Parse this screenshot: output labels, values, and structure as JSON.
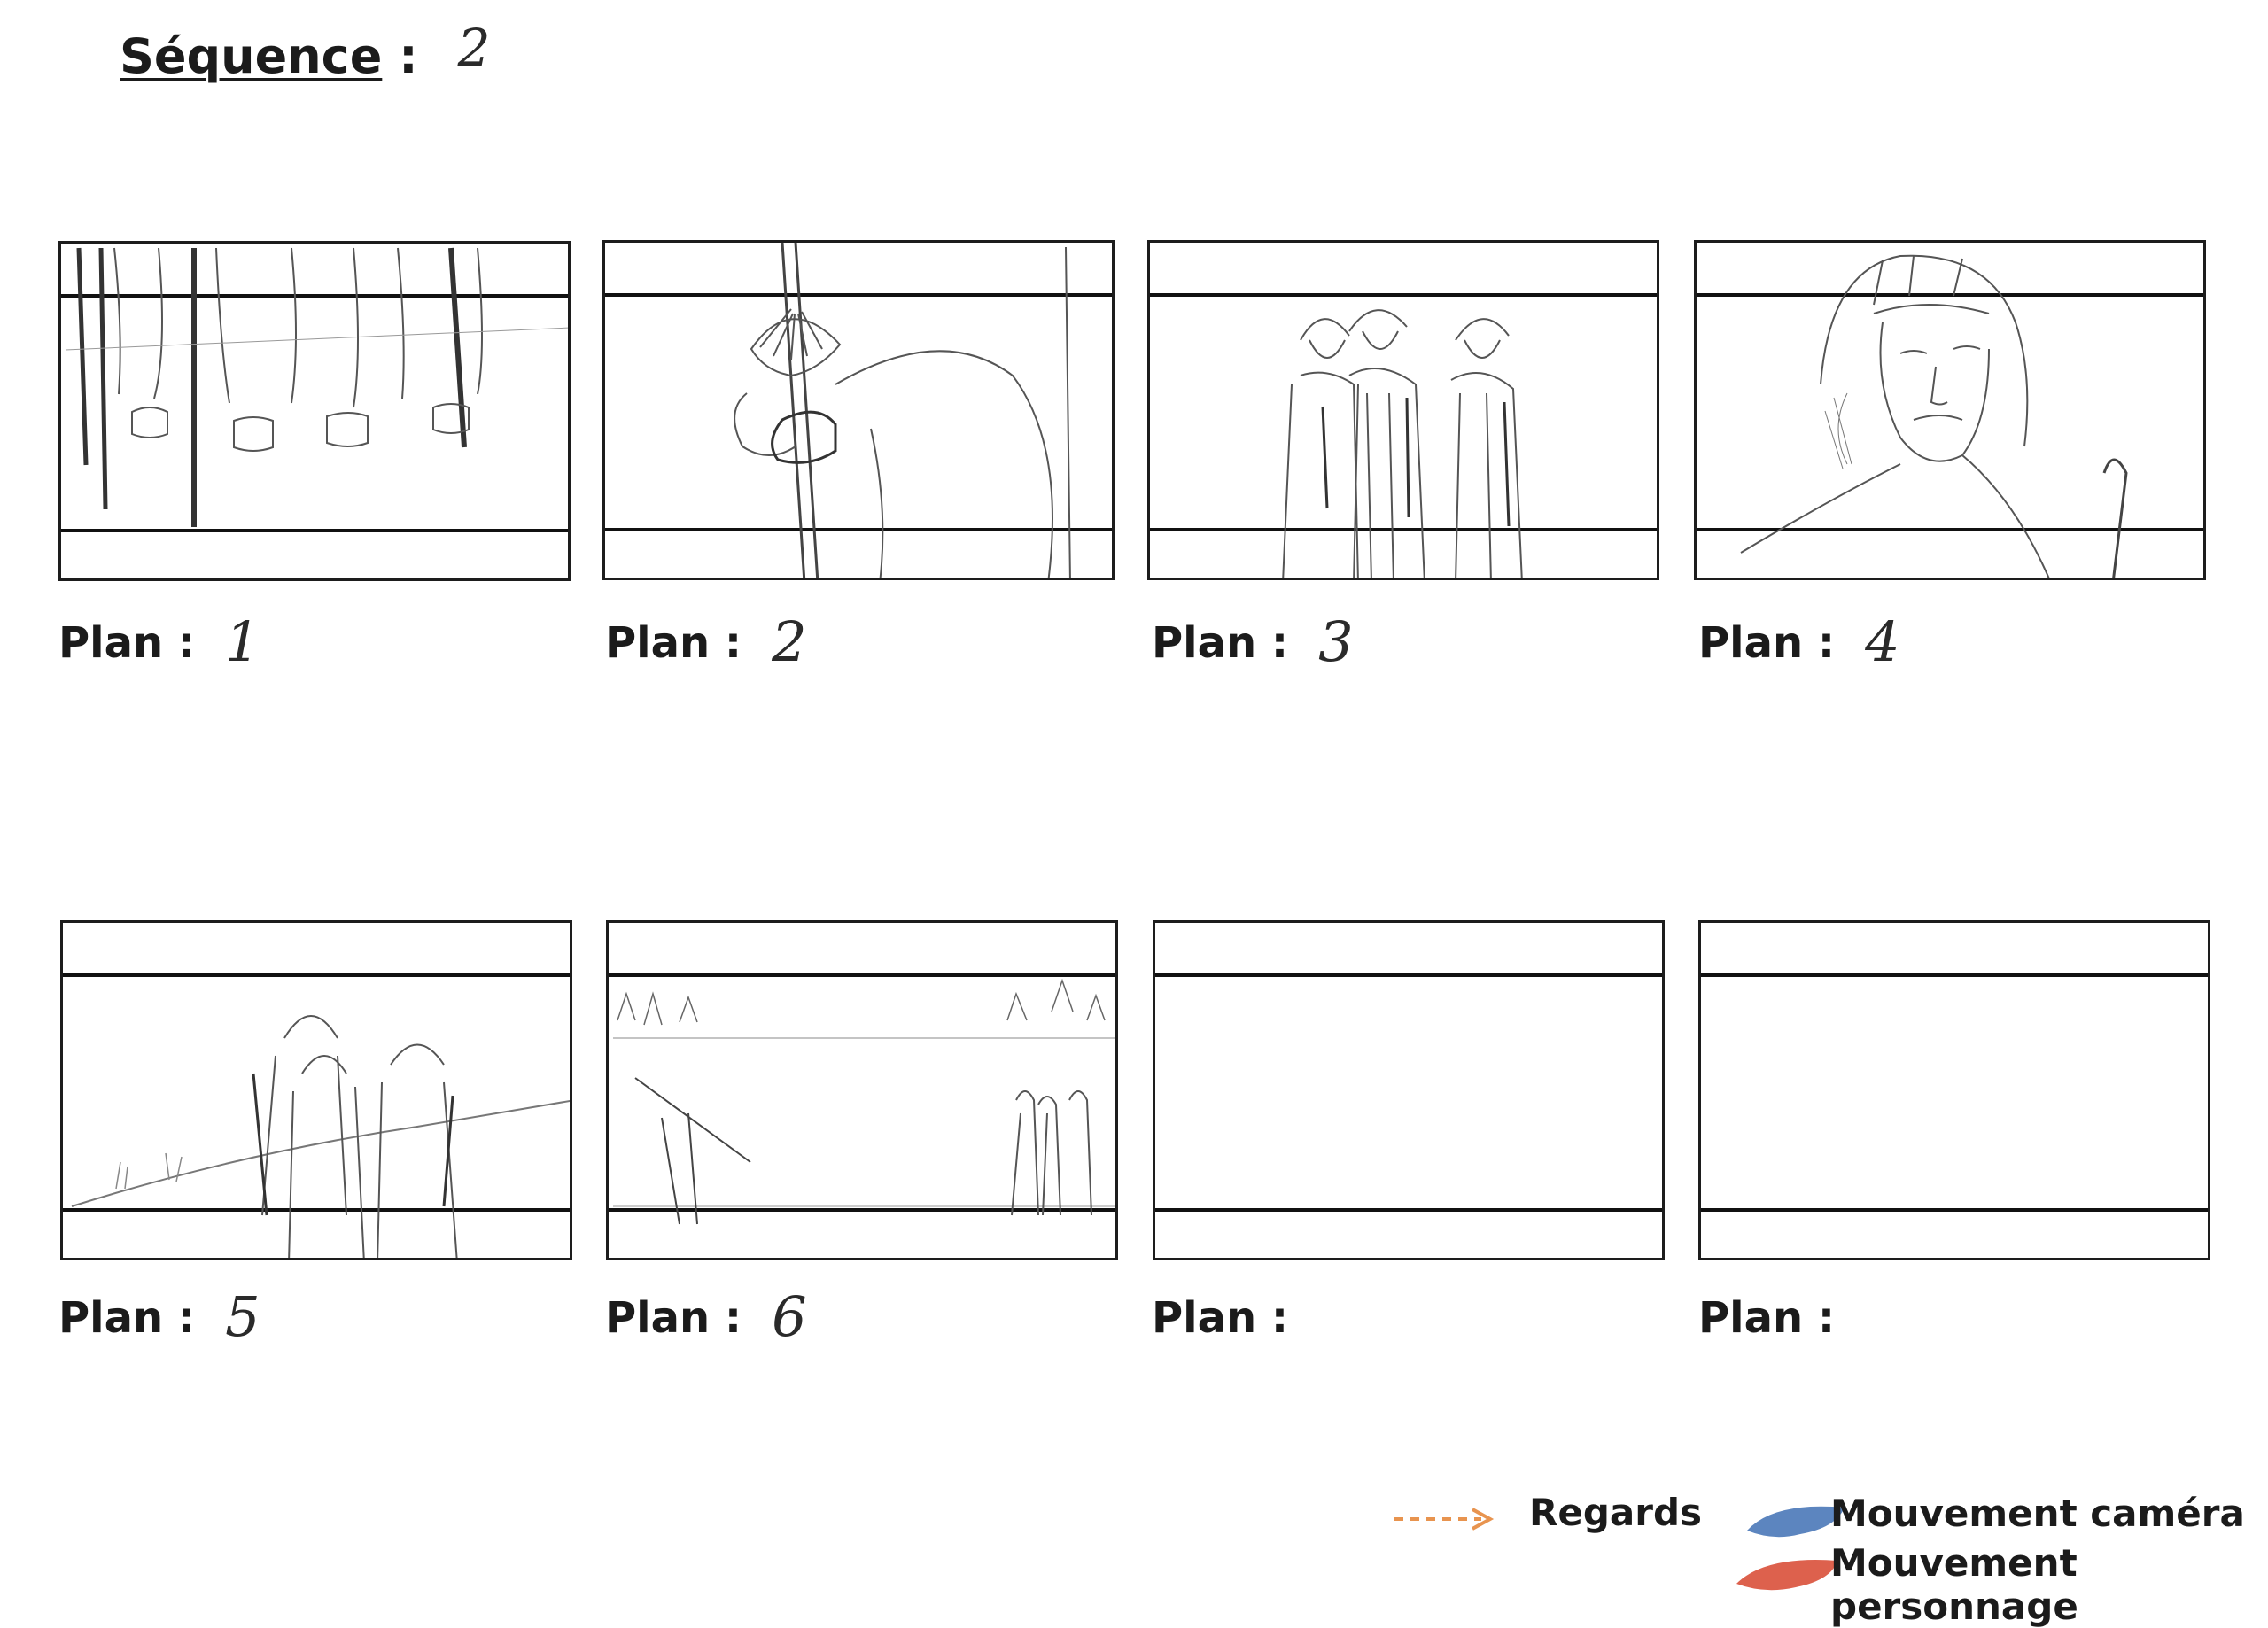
{
  "header": {
    "label": "Séquence",
    "colon": ":",
    "value": "2"
  },
  "panels": [
    {
      "plan_label": "Plan :",
      "plan_number": "1"
    },
    {
      "plan_label": "Plan :",
      "plan_number": "2"
    },
    {
      "plan_label": "Plan :",
      "plan_number": "3"
    },
    {
      "plan_label": "Plan :",
      "plan_number": "4"
    },
    {
      "plan_label": "Plan :",
      "plan_number": "5"
    },
    {
      "plan_label": "Plan :",
      "plan_number": "6"
    },
    {
      "plan_label": "Plan :",
      "plan_number": ""
    },
    {
      "plan_label": "Plan :",
      "plan_number": ""
    }
  ],
  "legend": {
    "regards": "Regards",
    "mouvement_camera": "Mouvement caméra",
    "mouvement_personnage": "Mouvement personnage",
    "colors": {
      "regards": "#e8944f",
      "camera": "#4a78b8",
      "personnage": "#d9503a"
    }
  }
}
